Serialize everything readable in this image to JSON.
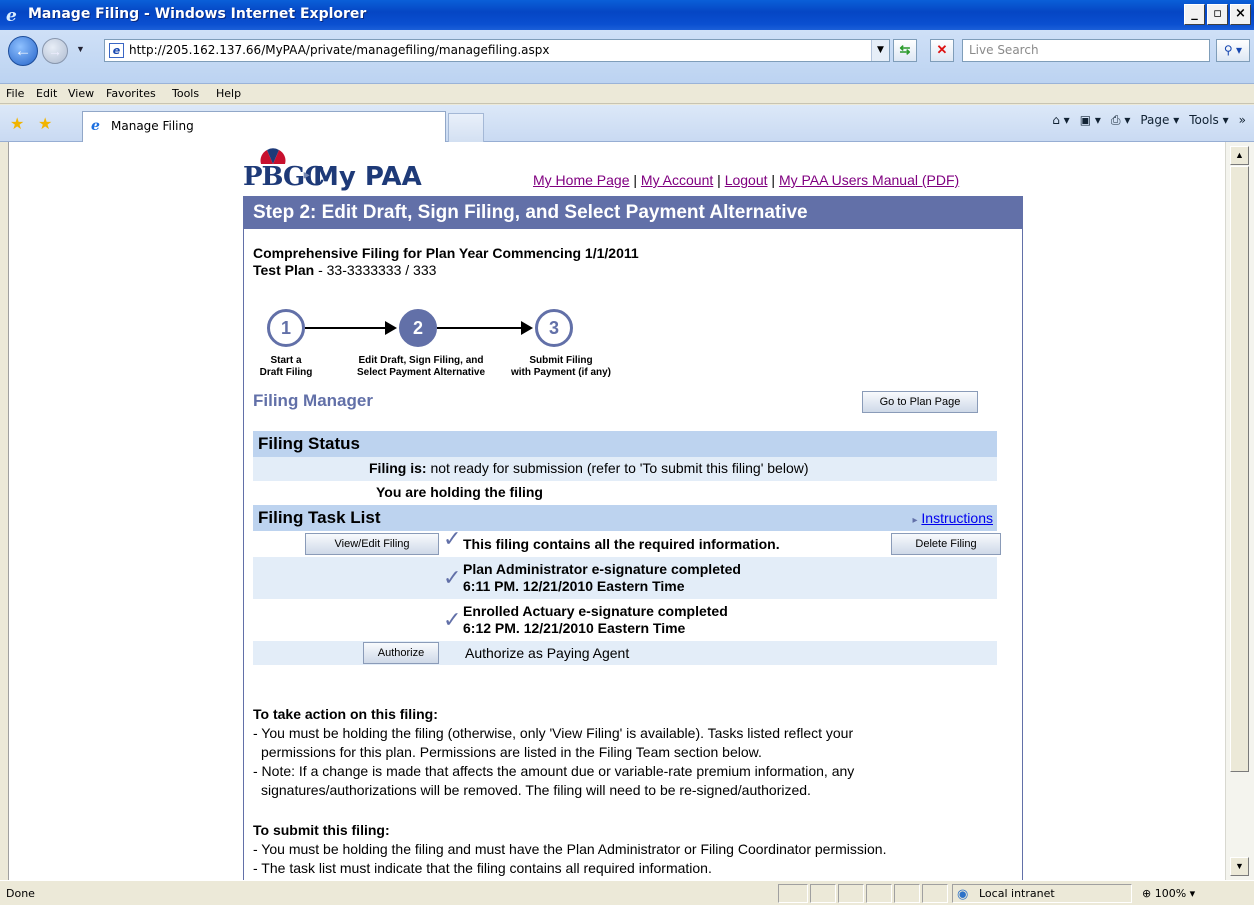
{
  "window": {
    "title": "Manage Filing - Windows Internet Explorer",
    "min_label": "_",
    "max_label": "▫",
    "close_label": "×"
  },
  "toolbar": {
    "url": "http://205.162.137.66/MyPAA/private/managefiling/managefiling.aspx",
    "search_placeholder": "Live Search"
  },
  "menu": [
    "File",
    "Edit",
    "View",
    "Favorites",
    "Tools",
    "Help"
  ],
  "tab": {
    "label": "Manage Filing"
  },
  "commandbar": {
    "page_label": "Page ▾",
    "tools_label": "Tools ▾"
  },
  "page": {
    "logo_pbgc": "PBGC",
    "logo_mypaa": "My PAA",
    "links": {
      "home": "My Home Page",
      "account": "My Account",
      "logout": "Logout",
      "manual": "My PAA Users Manual (PDF)"
    },
    "step_header": "Step 2: Edit Draft, Sign Filing, and Select Payment Alternative",
    "filing_title": "Comprehensive Filing for Plan Year Commencing 1/1/2011",
    "plan_label": "Test Plan",
    "plan_value": " - 33-3333333 / 333",
    "steps": [
      {
        "num": "1",
        "label1": "Start a",
        "label2": "Draft Filing"
      },
      {
        "num": "2",
        "label1": "Edit Draft, Sign Filing, and",
        "label2": "Select Payment Alternative"
      },
      {
        "num": "3",
        "label1": "Submit Filing",
        "label2": "with Payment (if any)"
      }
    ],
    "filing_manager": "Filing Manager",
    "goto_plan_btn": "Go to Plan Page",
    "status_head": "Filing Status",
    "filing_is_label": "Filing is:",
    "filing_is_value": " not ready for submission (refer to 'To submit this filing' below)",
    "holding_text": "You are holding the filing",
    "task_head": "Filing Task List",
    "instructions_link": "Instructions",
    "view_edit_btn": "View/Edit Filing",
    "task_required": "This filing contains all the required information.",
    "delete_btn": "Delete Filing",
    "pa_sig_line1": "Plan Administrator e-signature completed",
    "pa_sig_line2": "6:11 PM. 12/21/2010 Eastern Time",
    "ea_sig_line1": "Enrolled Actuary e-signature completed",
    "ea_sig_line2": "6:12 PM. 12/21/2010 Eastern Time",
    "authorize_btn": "Authorize",
    "authorize_text": "Authorize as Paying Agent",
    "action_head": "To take action on this filing:",
    "action_l1": "- You must be holding the filing (otherwise, only 'View Filing' is available). Tasks listed reflect your",
    "action_l2": "  permissions for this plan. Permissions are listed in the Filing Team section below.",
    "action_l3": "- Note: If a change is made that affects the amount due or variable-rate premium information, any",
    "action_l4": "  signatures/authorizations will be removed. The filing will need to be re-signed/authorized.",
    "submit_head": "To submit this filing:",
    "submit_l1": "- You must be holding the filing and must have the Plan Administrator or Filing Coordinator permission.",
    "submit_l2": "- The task list must indicate that the filing contains all required information."
  },
  "status": {
    "done": "Done",
    "zone": "Local intranet",
    "zoom": "100%"
  },
  "colors": {
    "header_bg": "#6270a8",
    "section_bg": "#bdd3ef",
    "row_alt_bg": "#e3edf8",
    "link_visited": "#800080"
  }
}
